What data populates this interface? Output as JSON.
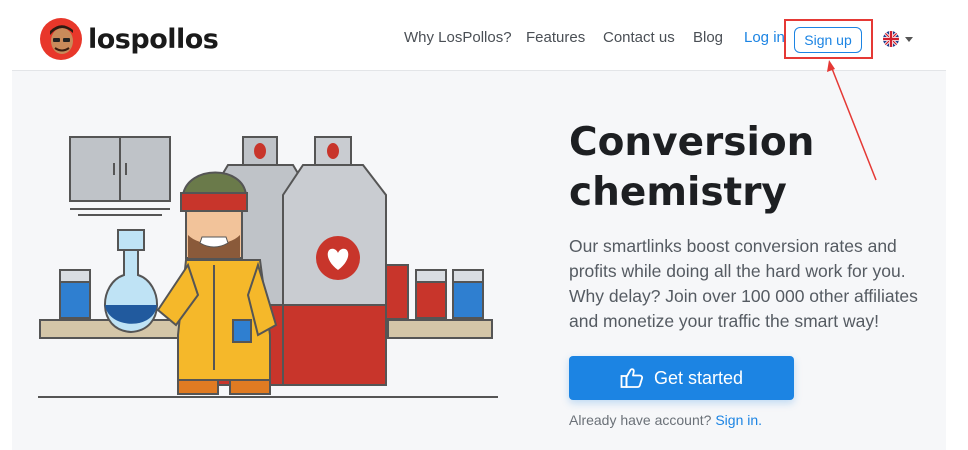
{
  "brand": {
    "name": "lospollos"
  },
  "nav": {
    "items": [
      {
        "label": "Why LosPollos?"
      },
      {
        "label": "Features"
      },
      {
        "label": "Contact us"
      },
      {
        "label": "Blog"
      }
    ],
    "login_label": "Log in",
    "signup_label": "Sign up",
    "language_icon": "uk-flag-icon"
  },
  "hero": {
    "title_line1": "Conversion",
    "title_line2": "chemistry",
    "text_line1": "Our smartlinks boost conversion rates and",
    "text_line2": "profits while doing all the hard work for you.",
    "text_line3": "Why delay? Join over 100 000 other affiliates",
    "text_line4": "and monetize your traffic the smart way!",
    "cta_label": "Get started",
    "cta_icon": "thumbs-up-icon",
    "already_text": "Already have account?",
    "signin_label": "Sign in."
  },
  "colors": {
    "accent": "#1c84e3",
    "annotation": "#e53935",
    "hero_bg": "#f6f7f9"
  }
}
